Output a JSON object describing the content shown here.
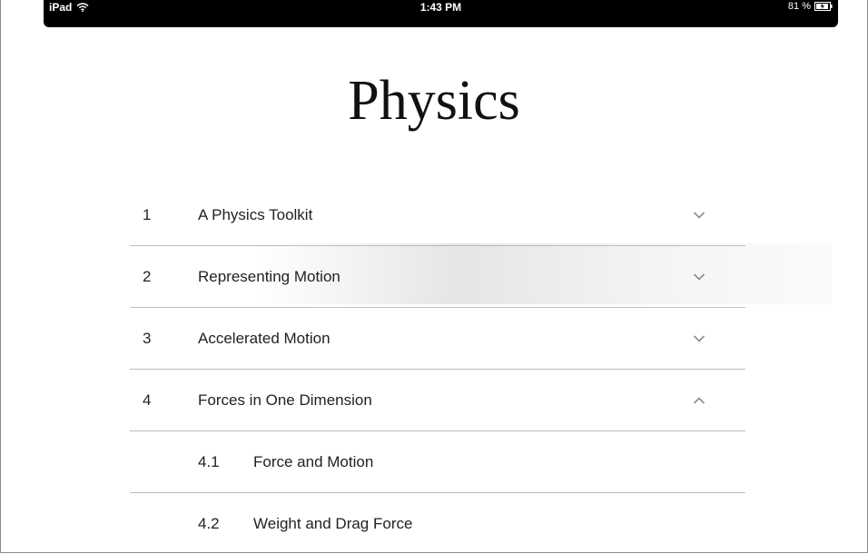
{
  "status_bar": {
    "device": "iPad",
    "time": "1:43 PM",
    "battery": "81 %"
  },
  "book": {
    "title": "Physics"
  },
  "toc": {
    "chapters": [
      {
        "number": "1",
        "title": "A Physics Toolkit",
        "expanded": false
      },
      {
        "number": "2",
        "title": "Representing Motion",
        "expanded": false
      },
      {
        "number": "3",
        "title": "Accelerated Motion",
        "expanded": false
      },
      {
        "number": "4",
        "title": "Forces in One Dimension",
        "expanded": true
      }
    ],
    "sections": [
      {
        "number": "4.1",
        "title": "Force and Motion"
      },
      {
        "number": "4.2",
        "title": "Weight and Drag Force"
      }
    ]
  },
  "icons": {
    "collapsed": "chevron-down-icon",
    "expanded": "chevron-up-icon",
    "wifi": "wifi-icon",
    "battery": "battery-icon"
  },
  "colors": {
    "status_bar_bg": "#000000",
    "divider": "#bdbdbd",
    "text": "#222222",
    "chevron": "#8a8a8a"
  }
}
